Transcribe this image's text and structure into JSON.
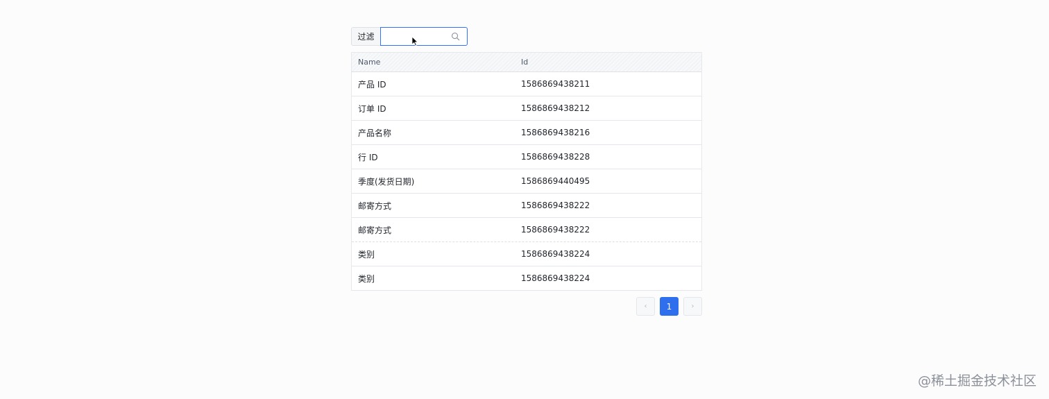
{
  "filter": {
    "label": "过滤",
    "value": "",
    "placeholder": "",
    "icon": "search-icon"
  },
  "table": {
    "columns": [
      "Name",
      "Id"
    ],
    "rows": [
      {
        "name": "产品 ID",
        "id": "1586869438211"
      },
      {
        "name": "订单 ID",
        "id": "1586869438212"
      },
      {
        "name": "产品名称",
        "id": "1586869438216"
      },
      {
        "name": "行 ID",
        "id": "1586869438228"
      },
      {
        "name": "季度(发货日期)",
        "id": "1586869440495"
      },
      {
        "name": "邮寄方式",
        "id": "1586869438222"
      },
      {
        "name": "邮寄方式",
        "id": "1586869438222"
      },
      {
        "name": "类别",
        "id": "1586869438224"
      },
      {
        "name": "类别",
        "id": "1586869438224"
      }
    ]
  },
  "pagination": {
    "prev": "‹",
    "current": "1",
    "next": "›"
  },
  "watermark": "@稀土掘金技术社区",
  "colors": {
    "accent": "#2f6fed",
    "input_focus_border": "#3370ff"
  }
}
